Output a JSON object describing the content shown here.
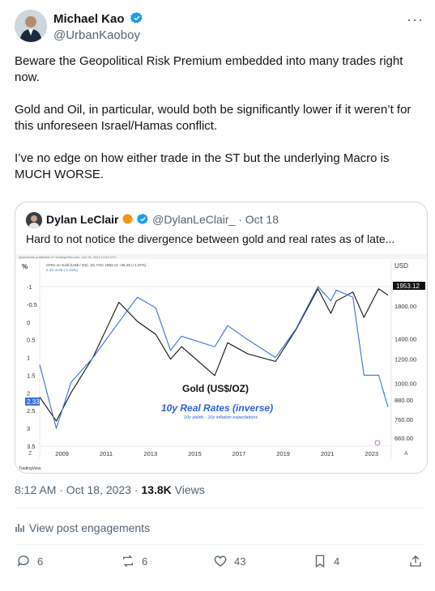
{
  "author": {
    "name": "Michael Kao",
    "handle": "@UrbanKaoboy"
  },
  "tweet": {
    "text": "Beware the Geopolitical Risk Premium embedded into many trades right now.\n\nGold and Oil, in particular, would both be significantly lower if it weren’t for this unforeseen Israel/Hamas conflict.\n\nI’ve no edge on how either trade in the ST but the underlying Macro is MUCH WORSE."
  },
  "quote": {
    "name": "Dylan LeClair",
    "handle": "@DylanLeClair_",
    "date": "Oct 18",
    "text": "Hard to not notice the divergence between gold and real rates as of late..."
  },
  "chart_image": {
    "source_line": "dylanleclair published on TradingView.com, Oct 18, 2023 14:32 UTC",
    "legend_line1": "CFDs on Gold (US$ / OZ), 1D, FXC  1953.12  +36.28 (+1.97%)",
    "legend_line2": "2.33  -0.03 (-1.21%)",
    "left_unit": "%",
    "right_unit": "USD",
    "label_gold": "Gold (US$/OZ)",
    "label_rates": "10y Real Rates (inverse)",
    "label_rates_sub": "10y yields - 10y inflation expectations",
    "gold_price_badge": "1953.12",
    "rate_badge": "2.33",
    "corner_left": "Z",
    "corner_right": "A",
    "logo_text": "TradingView",
    "colors": {
      "gold_line": "#111111",
      "rates_line": "#3a6fd8",
      "rates_text": "#2d62d8",
      "background": "#ffffff"
    }
  },
  "chart_data": [
    {
      "type": "line",
      "xlabel": "",
      "ylabel": "",
      "x_ticks": [
        "2009",
        "2011",
        "2013",
        "2015",
        "2017",
        "2019",
        "2021",
        "2023"
      ],
      "y_left_ticks": [
        "-1",
        "-0.5",
        "0",
        "0.5",
        "1",
        "1.5",
        "2",
        "2.5",
        "3",
        "3.5"
      ],
      "y_left_range": [
        -1.2,
        3.5
      ],
      "y_right_ticks": [
        "1800.00",
        "1400.00",
        "1200.00",
        "1000.00",
        "880.00",
        "760.00",
        "660.00"
      ],
      "series": [
        {
          "name": "Gold (US$/OZ)",
          "axis": "right",
          "x": [
            "2008-01",
            "2008-10",
            "2009-06",
            "2010-06",
            "2011-08",
            "2012-06",
            "2013-04",
            "2013-12",
            "2014-06",
            "2015-12",
            "2016-07",
            "2017-06",
            "2018-09",
            "2019-08",
            "2020-08",
            "2021-03",
            "2021-06",
            "2022-03",
            "2022-09",
            "2023-05",
            "2023-10"
          ],
          "values": [
            900,
            750,
            930,
            1220,
            1850,
            1600,
            1450,
            1200,
            1320,
            1060,
            1360,
            1250,
            1180,
            1500,
            2050,
            1700,
            1870,
            2000,
            1650,
            2050,
            1953
          ]
        },
        {
          "name": "10y Real Rates (inverse)",
          "axis": "left",
          "x": [
            "2008-01",
            "2008-10",
            "2009-06",
            "2010-06",
            "2011-08",
            "2012-06",
            "2013-04",
            "2013-12",
            "2014-06",
            "2015-12",
            "2016-07",
            "2017-06",
            "2018-09",
            "2019-08",
            "2020-08",
            "2021-03",
            "2021-06",
            "2022-03",
            "2022-09",
            "2023-05",
            "2023-10"
          ],
          "values": [
            1.2,
            3.0,
            1.7,
            1.0,
            0.0,
            -0.7,
            -0.4,
            0.8,
            0.4,
            0.7,
            0.1,
            0.5,
            1.0,
            0.2,
            -1.0,
            -0.6,
            -0.9,
            -0.7,
            1.5,
            1.5,
            2.4
          ]
        }
      ]
    }
  ],
  "meta": {
    "time": "8:12 AM · Oct 18, 2023 · ",
    "views": "13.8K",
    "views_label": " Views"
  },
  "engagements_label": "View post engagements",
  "actions": {
    "replies": "6",
    "reposts": "6",
    "likes": "43",
    "bookmarks": "4"
  }
}
